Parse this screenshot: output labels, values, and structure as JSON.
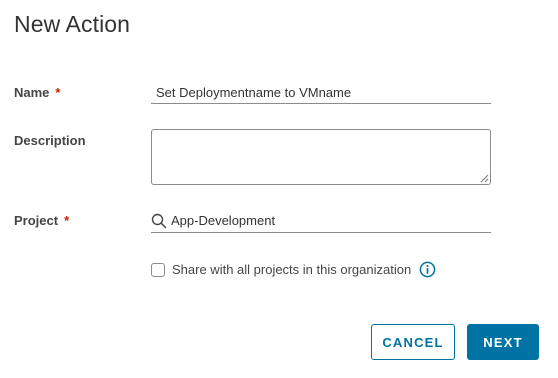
{
  "dialog": {
    "title": "New Action"
  },
  "form": {
    "name": {
      "label": "Name",
      "required_mark": "*",
      "value": "Set Deploymentname to VMname"
    },
    "description": {
      "label": "Description",
      "value": ""
    },
    "project": {
      "label": "Project",
      "required_mark": "*",
      "value": "App-Development",
      "icon": "search-icon"
    },
    "share": {
      "label": "Share with all projects in this organization",
      "checked": false,
      "info_icon": "info-icon"
    }
  },
  "buttons": {
    "cancel": "CANCEL",
    "next": "NEXT"
  },
  "colors": {
    "primary": "#0072a3",
    "required": "#c92100",
    "border": "#8c8c8c",
    "text": "#333333"
  }
}
